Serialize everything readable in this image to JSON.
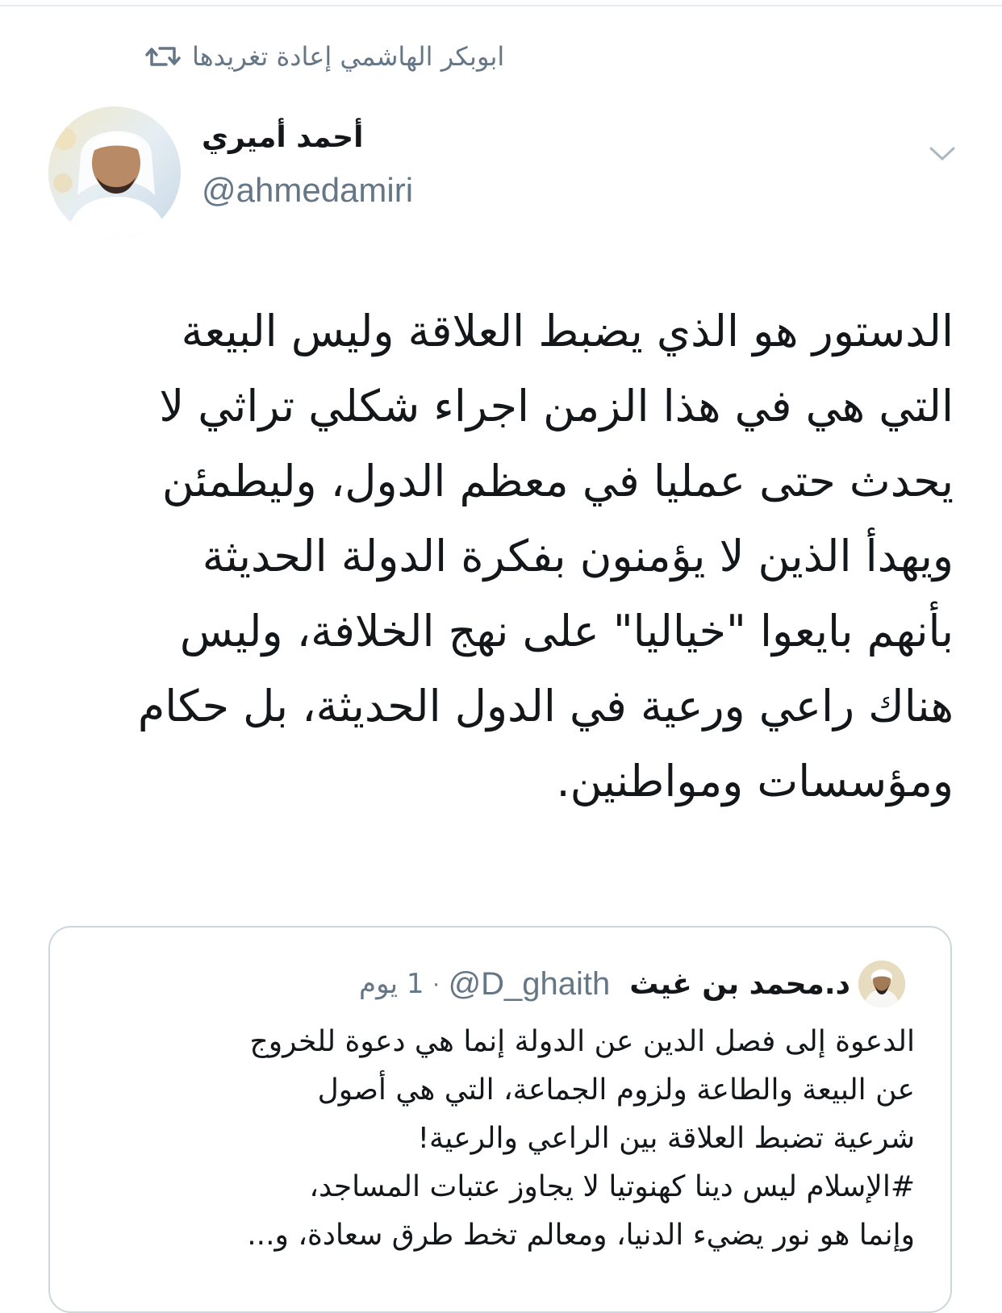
{
  "retweet_context": {
    "text": "ابوبكر الهاشمي إعادة تغريدها",
    "icon": "retweet-icon"
  },
  "tweet": {
    "author": {
      "name": "أحمد أميري",
      "handle": "@ahmedamiri",
      "avatar": "avatar-photo"
    },
    "menu_icon": "chevron-down-icon",
    "text_lines": [
      "الدستور هو الذي يضبط العلاقة وليس البيعة",
      "التي هي في هذا الزمن اجراء شكلي تراثي لا",
      "يحدث حتى عمليا في معظم الدول، وليطمئن",
      "ويهدأ الذين لا يؤمنون بفكرة الدولة الحديثة",
      "بأنهم بايعوا \"خياليا\" على نهج الخلافة، وليس",
      "هناك راعي ورعية في الدول الحديثة، بل حكام",
      "ومؤسسات ومواطنين."
    ]
  },
  "quoted_tweet": {
    "author": {
      "name": "د.محمد بن غيث",
      "handle": "@D_ghaith",
      "avatar": "avatar-photo"
    },
    "separator": "·",
    "time": "1 يوم",
    "text_lines": [
      "الدعوة إلى فصل الدين عن الدولة إنما هي دعوة للخروج",
      "عن البيعة والطاعة ولزوم الجماعة، التي هي أصول",
      "شرعية تضبط العلاقة بين الراعي والرعية!",
      "#الإسلام ليس دينا كهنوتيا لا يجاوز عتبات المساجد،",
      "وإنما هو نور يضيء الدنيا، ومعالم تخط طرق سعادة، و..."
    ]
  },
  "colors": {
    "text_primary": "#14171a",
    "text_secondary": "#657786",
    "border": "#ccd6dd",
    "background": "#ffffff"
  }
}
